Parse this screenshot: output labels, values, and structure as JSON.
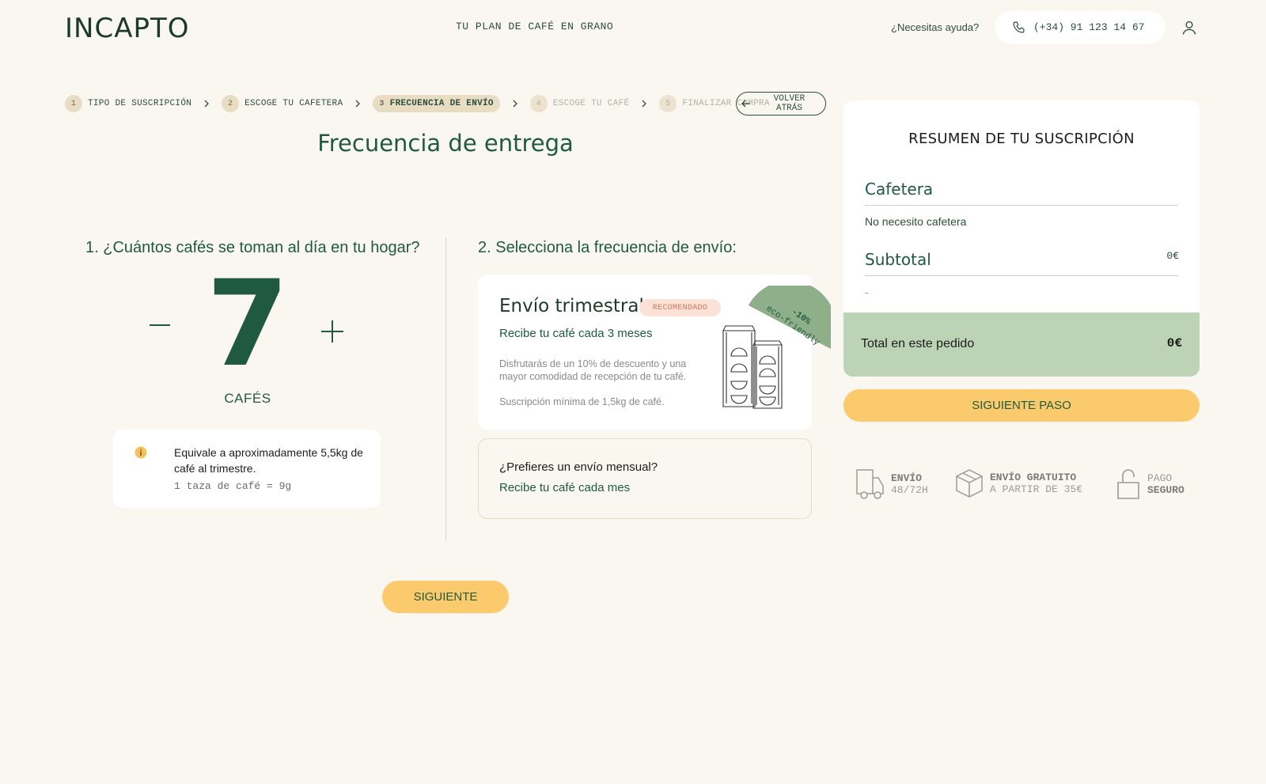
{
  "header": {
    "logo": "INCAPTO",
    "tagline": "TU PLAN DE CAFÉ EN GRANO",
    "help": "¿Necesitas ayuda?",
    "phone": "(+34) 91 123 14 67",
    "phone_icon": "phone-icon",
    "user_icon": "user-icon"
  },
  "stepper": {
    "steps": [
      {
        "num": "1",
        "label": "TIPO DE SUSCRIPCIÓN"
      },
      {
        "num": "2",
        "label": "ESCOGE TU CAFETERA"
      },
      {
        "num": "3",
        "label": "FRECUENCIA DE ENVÍO"
      },
      {
        "num": "4",
        "label": "ESCOGE TU CAFÉ"
      },
      {
        "num": "5",
        "label": "FINALIZAR COMPRA"
      }
    ],
    "back_label": "VOLVER ATRÁS"
  },
  "main": {
    "title": "Frecuencia de entrega",
    "q1": "1. ¿Cuántos cafés se toman al día en tu hogar?",
    "count": "7",
    "count_label": "CAFÉS",
    "info_text": "Equivale a aproximadamente 5,5kg de café al trimestre.",
    "info_sub": "1 taza de café = 9g",
    "info_icon_glyph": "i",
    "q2": "2. Selecciona la frecuencia de envío:",
    "quarterly": {
      "title": "Envío trimestral",
      "badge": "RECOMENDADO",
      "subtitle": "Recibe tu café cada 3 meses",
      "description": "Disfrutarás de un 10% de descuento y una mayor comodidad de recepción de tu café.",
      "minimum": "Suscripción mínima de 1,5kg de café.",
      "eco_discount": "-10%",
      "eco_label": "eco-friendly"
    },
    "monthly": {
      "title": "¿Prefieres un envío mensual?",
      "subtitle": "Recibe tu café cada mes"
    },
    "next_label": "SIGUIENTE"
  },
  "summary": {
    "title": "RESUMEN DE TU SUSCRIPCIÓN",
    "cafetera_label": "Cafetera",
    "cafetera_value": "No necesito cafetera",
    "subtotal_label": "Subtotal",
    "subtotal_value": "0€",
    "subtotal_detail": "-",
    "total_label": "Total en este pedido",
    "total_value": "0€",
    "next_step_label": "SIGUIENTE PASO"
  },
  "features": [
    {
      "line1": "ENVÍO",
      "line2": "48/72H",
      "icon": "delivery-truck-icon"
    },
    {
      "line1": "ENVÍO GRATUITO",
      "line2": "A PARTIR DE 35€",
      "icon": "package-box-icon"
    },
    {
      "line1": "PAGO",
      "line2": "SEGURO",
      "icon": "padlock-icon"
    }
  ],
  "colors": {
    "background": "#faf7f0",
    "brand_green": "#1f5a40",
    "accent_yellow": "#fbca6d",
    "summary_green": "#bcd4b5",
    "eco_green": "#8fae8a",
    "badge_bg": "#fbe1d6"
  }
}
